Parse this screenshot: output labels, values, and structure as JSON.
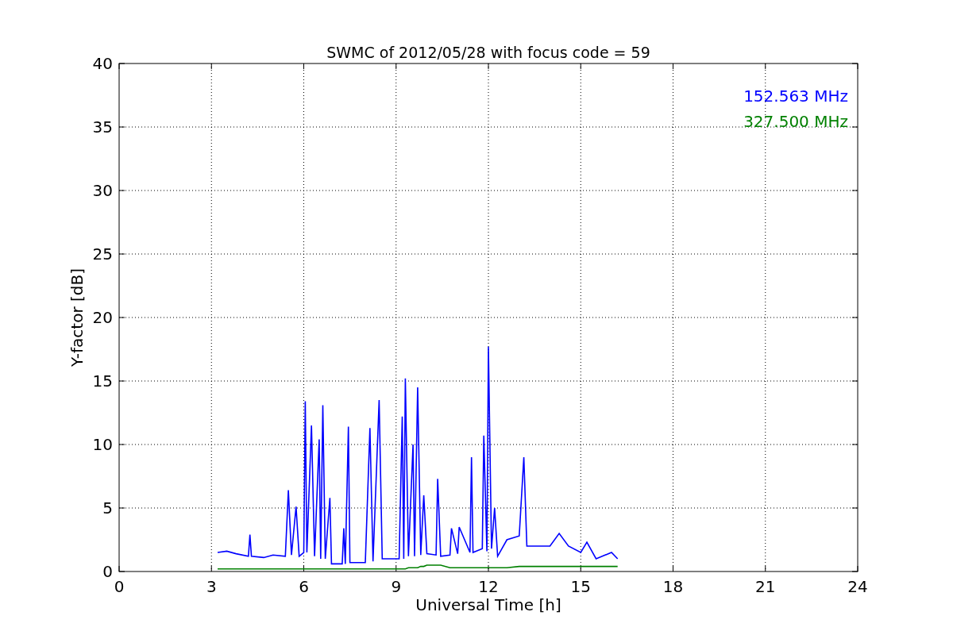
{
  "chart_data": {
    "type": "line",
    "title": "SWMC of 2012/05/28 with focus code = 59",
    "xlabel": "Universal Time [h]",
    "ylabel": "Y-factor [dB]",
    "xlim": [
      0,
      24
    ],
    "ylim": [
      0,
      40
    ],
    "xticks": [
      0,
      3,
      6,
      9,
      12,
      15,
      18,
      21,
      24
    ],
    "yticks": [
      0,
      5,
      10,
      15,
      20,
      25,
      30,
      35,
      40
    ],
    "grid": true,
    "x": [
      3.2,
      3.5,
      3.8,
      4.2,
      4.25,
      4.3,
      4.7,
      5.0,
      5.4,
      5.5,
      5.6,
      5.75,
      5.85,
      6.0,
      6.05,
      6.1,
      6.25,
      6.35,
      6.5,
      6.55,
      6.62,
      6.7,
      6.85,
      6.9,
      7.25,
      7.3,
      7.35,
      7.45,
      7.5,
      8.0,
      8.15,
      8.25,
      8.45,
      8.55,
      9.1,
      9.2,
      9.25,
      9.3,
      9.4,
      9.55,
      9.6,
      9.7,
      9.8,
      9.9,
      10.0,
      10.3,
      10.35,
      10.45,
      10.75,
      10.8,
      11.0,
      11.05,
      11.4,
      11.45,
      11.5,
      11.8,
      11.85,
      11.95,
      12.0,
      12.1,
      12.2,
      12.3,
      12.6,
      13.0,
      13.15,
      13.25,
      13.5,
      14.0,
      14.3,
      14.6,
      15.0,
      15.2,
      15.5,
      16.0,
      16.2
    ],
    "series": [
      {
        "name": "152.563 MHz",
        "color": "#0000ff",
        "values": [
          1.5,
          1.6,
          1.4,
          1.2,
          2.9,
          1.2,
          1.1,
          1.3,
          1.2,
          6.4,
          1.3,
          5.1,
          1.2,
          1.5,
          13.4,
          1.5,
          11.5,
          1.2,
          10.4,
          1.0,
          13.1,
          1.0,
          5.8,
          0.6,
          0.6,
          3.4,
          0.6,
          11.4,
          0.7,
          0.7,
          11.3,
          0.8,
          13.5,
          1.0,
          1.0,
          12.2,
          1.0,
          15.2,
          1.2,
          10.0,
          1.2,
          14.5,
          1.3,
          6.0,
          1.4,
          1.3,
          7.3,
          1.2,
          1.3,
          3.4,
          1.4,
          3.5,
          1.5,
          9.0,
          1.5,
          1.8,
          10.7,
          1.6,
          17.7,
          1.8,
          5.0,
          1.2,
          2.5,
          2.8,
          9.0,
          2.0,
          2.0,
          2.0,
          3.0,
          2.0,
          1.5,
          2.3,
          1.0,
          1.5,
          1.0
        ]
      },
      {
        "name": "327.500 MHz",
        "color": "#008000",
        "values": [
          0.2,
          0.2,
          0.2,
          0.2,
          0.2,
          0.2,
          0.2,
          0.2,
          0.2,
          0.2,
          0.2,
          0.2,
          0.2,
          0.2,
          0.2,
          0.2,
          0.2,
          0.2,
          0.2,
          0.2,
          0.2,
          0.2,
          0.2,
          0.2,
          0.2,
          0.2,
          0.2,
          0.2,
          0.2,
          0.2,
          0.2,
          0.2,
          0.2,
          0.2,
          0.2,
          0.2,
          0.2,
          0.2,
          0.3,
          0.3,
          0.3,
          0.3,
          0.4,
          0.4,
          0.5,
          0.5,
          0.5,
          0.5,
          0.3,
          0.3,
          0.3,
          0.3,
          0.3,
          0.3,
          0.3,
          0.3,
          0.3,
          0.3,
          0.3,
          0.3,
          0.3,
          0.3,
          0.3,
          0.4,
          0.4,
          0.4,
          0.4,
          0.4,
          0.4,
          0.4,
          0.4,
          0.4,
          0.4,
          0.4,
          0.4
        ]
      }
    ]
  }
}
